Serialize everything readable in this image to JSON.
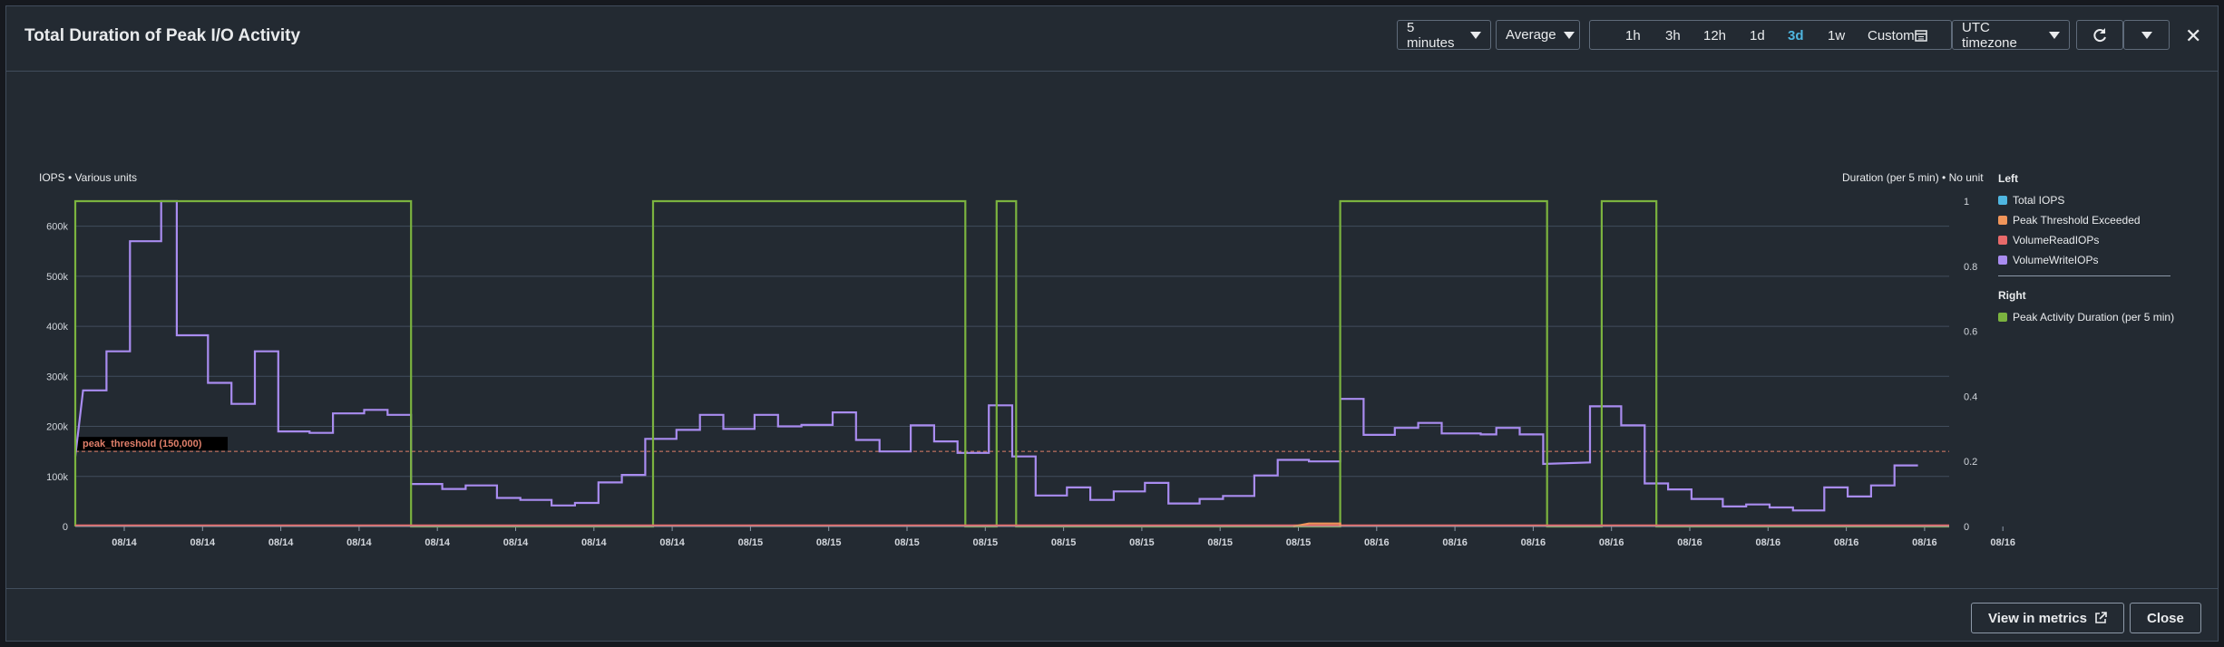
{
  "title": "Total Duration of Peak I/O Activity",
  "toolbar": {
    "period": "5 minutes",
    "statistic": "Average",
    "ranges": [
      "1h",
      "3h",
      "12h",
      "1d",
      "3d",
      "1w"
    ],
    "active_range": "3d",
    "custom": "Custom",
    "timezone": "UTC timezone"
  },
  "footer": {
    "view_metrics": "View in metrics",
    "close": "Close"
  },
  "chart_data": {
    "type": "line",
    "left_axis_label": "IOPS • Various units",
    "right_axis_label": "Duration (per 5 min) • No unit",
    "left_ticks": [
      "0",
      "100k",
      "200k",
      "300k",
      "400k",
      "500k",
      "600k"
    ],
    "right_ticks": [
      "0",
      "0.2",
      "0.4",
      "0.6",
      "0.8",
      "1"
    ],
    "ylim_left": [
      0,
      650000
    ],
    "ylim_right": [
      0,
      1
    ],
    "x_tick_labels": [
      "08/14",
      "08/14",
      "08/14",
      "08/14",
      "08/14",
      "08/14",
      "08/14",
      "08/14",
      "08/15",
      "08/15",
      "08/15",
      "08/15",
      "08/15",
      "08/15",
      "08/15",
      "08/15",
      "08/16",
      "08/16",
      "08/16",
      "08/16",
      "08/16",
      "08/16",
      "08/16",
      "08/16",
      "08/16"
    ],
    "threshold": {
      "label": "peak_threshold (150,000)",
      "value": 150000,
      "color": "#e07f6a"
    },
    "legend": {
      "left_title": "Left",
      "right_title": "Right",
      "left": [
        {
          "name": "Total IOPS",
          "color": "#4fb6e0"
        },
        {
          "name": "Peak Threshold Exceeded",
          "color": "#f0955a"
        },
        {
          "name": "VolumeReadIOPs",
          "color": "#e86a6a"
        },
        {
          "name": "VolumeWriteIOPs",
          "color": "#a98cf0"
        }
      ],
      "right": [
        {
          "name": "Peak Activity Duration (per 5 min)",
          "color": "#7bb33f"
        }
      ]
    },
    "x_range": [
      0,
      240
    ],
    "series": [
      {
        "name": "VolumeWriteIOPs",
        "axis": "left",
        "color": "#a98cf0",
        "values": [
          [
            0,
            140000
          ],
          [
            1,
            272000
          ],
          [
            4,
            272000
          ],
          [
            4,
            350000
          ],
          [
            7,
            350000
          ],
          [
            7,
            570000
          ],
          [
            11,
            570000
          ],
          [
            11,
            650000
          ],
          [
            13,
            650000
          ],
          [
            13,
            382000
          ],
          [
            17,
            382000
          ],
          [
            17,
            287000
          ],
          [
            20,
            287000
          ],
          [
            20,
            245000
          ],
          [
            23,
            245000
          ],
          [
            23,
            350000
          ],
          [
            26,
            350000
          ],
          [
            26,
            190000
          ],
          [
            30,
            190000
          ],
          [
            30,
            187000
          ],
          [
            33,
            187000
          ],
          [
            33,
            226000
          ],
          [
            37,
            226000
          ],
          [
            37,
            233000
          ],
          [
            40,
            233000
          ],
          [
            40,
            223000
          ],
          [
            43,
            223000
          ],
          [
            43,
            85000
          ],
          [
            47,
            85000
          ],
          [
            47,
            75000
          ],
          [
            50,
            75000
          ],
          [
            50,
            82000
          ],
          [
            54,
            82000
          ],
          [
            54,
            57000
          ],
          [
            57,
            57000
          ],
          [
            57,
            53000
          ],
          [
            61,
            53000
          ],
          [
            61,
            42000
          ],
          [
            64,
            42000
          ],
          [
            64,
            47000
          ],
          [
            67,
            47000
          ],
          [
            67,
            88000
          ],
          [
            70,
            88000
          ],
          [
            70,
            103000
          ],
          [
            73,
            103000
          ],
          [
            73,
            175000
          ],
          [
            77,
            175000
          ],
          [
            77,
            193000
          ],
          [
            80,
            193000
          ],
          [
            80,
            223000
          ],
          [
            83,
            223000
          ],
          [
            83,
            195000
          ],
          [
            87,
            195000
          ],
          [
            87,
            223000
          ],
          [
            90,
            223000
          ],
          [
            90,
            200000
          ],
          [
            93,
            200000
          ],
          [
            93,
            203000
          ],
          [
            97,
            203000
          ],
          [
            97,
            228000
          ],
          [
            100,
            228000
          ],
          [
            100,
            173000
          ],
          [
            103,
            173000
          ],
          [
            103,
            150000
          ],
          [
            107,
            150000
          ],
          [
            107,
            202000
          ],
          [
            110,
            202000
          ],
          [
            110,
            170000
          ],
          [
            113,
            170000
          ],
          [
            113,
            147000
          ],
          [
            117,
            147000
          ],
          [
            117,
            242000
          ],
          [
            120,
            242000
          ],
          [
            120,
            140000
          ],
          [
            123,
            140000
          ],
          [
            123,
            62000
          ],
          [
            127,
            62000
          ],
          [
            127,
            78000
          ],
          [
            130,
            78000
          ],
          [
            130,
            53000
          ],
          [
            133,
            53000
          ],
          [
            133,
            70000
          ],
          [
            137,
            70000
          ],
          [
            137,
            87000
          ],
          [
            140,
            87000
          ],
          [
            140,
            46000
          ],
          [
            144,
            46000
          ],
          [
            144,
            55000
          ],
          [
            147,
            55000
          ],
          [
            147,
            61000
          ],
          [
            151,
            61000
          ],
          [
            151,
            102000
          ],
          [
            154,
            102000
          ],
          [
            154,
            133000
          ],
          [
            158,
            133000
          ],
          [
            158,
            130000
          ],
          [
            162,
            130000
          ],
          [
            162,
            255000
          ],
          [
            165,
            255000
          ],
          [
            165,
            183000
          ],
          [
            169,
            183000
          ],
          [
            169,
            197000
          ],
          [
            172,
            197000
          ],
          [
            172,
            207000
          ],
          [
            175,
            207000
          ],
          [
            175,
            186000
          ],
          [
            180,
            186000
          ],
          [
            180,
            184000
          ],
          [
            182,
            184000
          ],
          [
            182,
            197000
          ],
          [
            185,
            197000
          ],
          [
            185,
            184000
          ],
          [
            188,
            184000
          ],
          [
            188,
            125000
          ],
          [
            194,
            128000
          ],
          [
            194,
            240000
          ],
          [
            198,
            240000
          ],
          [
            198,
            202000
          ],
          [
            201,
            202000
          ],
          [
            201,
            86000
          ],
          [
            204,
            86000
          ],
          [
            204,
            74000
          ],
          [
            207,
            74000
          ],
          [
            207,
            55000
          ],
          [
            211,
            55000
          ],
          [
            211,
            40000
          ],
          [
            214,
            40000
          ],
          [
            214,
            44000
          ],
          [
            217,
            44000
          ],
          [
            217,
            38000
          ],
          [
            220,
            38000
          ],
          [
            220,
            32000
          ],
          [
            224,
            32000
          ],
          [
            224,
            78000
          ],
          [
            227,
            78000
          ],
          [
            227,
            60000
          ],
          [
            230,
            60000
          ],
          [
            230,
            82000
          ],
          [
            233,
            82000
          ],
          [
            233,
            122000
          ],
          [
            236,
            122000
          ]
        ]
      },
      {
        "name": "Peak Activity Duration (per 5 min)",
        "axis": "right",
        "color": "#7bb33f",
        "values": [
          [
            0,
            0
          ],
          [
            0,
            1
          ],
          [
            43,
            1
          ],
          [
            43,
            0
          ],
          [
            74,
            0
          ],
          [
            74,
            1
          ],
          [
            114,
            1
          ],
          [
            114,
            0
          ],
          [
            118,
            0
          ],
          [
            118,
            1
          ],
          [
            120.5,
            1
          ],
          [
            120.5,
            0
          ],
          [
            162,
            0
          ],
          [
            162,
            1
          ],
          [
            188.5,
            1
          ],
          [
            188.5,
            0
          ],
          [
            195.5,
            0
          ],
          [
            195.5,
            1
          ],
          [
            202.5,
            1
          ],
          [
            202.5,
            0
          ],
          [
            240,
            0
          ]
        ]
      },
      {
        "name": "VolumeReadIOPs",
        "axis": "left",
        "color": "#e86a6a",
        "values": [
          [
            0,
            2000
          ],
          [
            240,
            2000
          ]
        ]
      },
      {
        "name": "Peak Threshold Exceeded",
        "axis": "left",
        "color": "#f0955a",
        "values": [
          [
            156,
            0
          ],
          [
            158,
            6000
          ],
          [
            162,
            6000
          ],
          [
            162,
            0
          ]
        ]
      }
    ]
  }
}
